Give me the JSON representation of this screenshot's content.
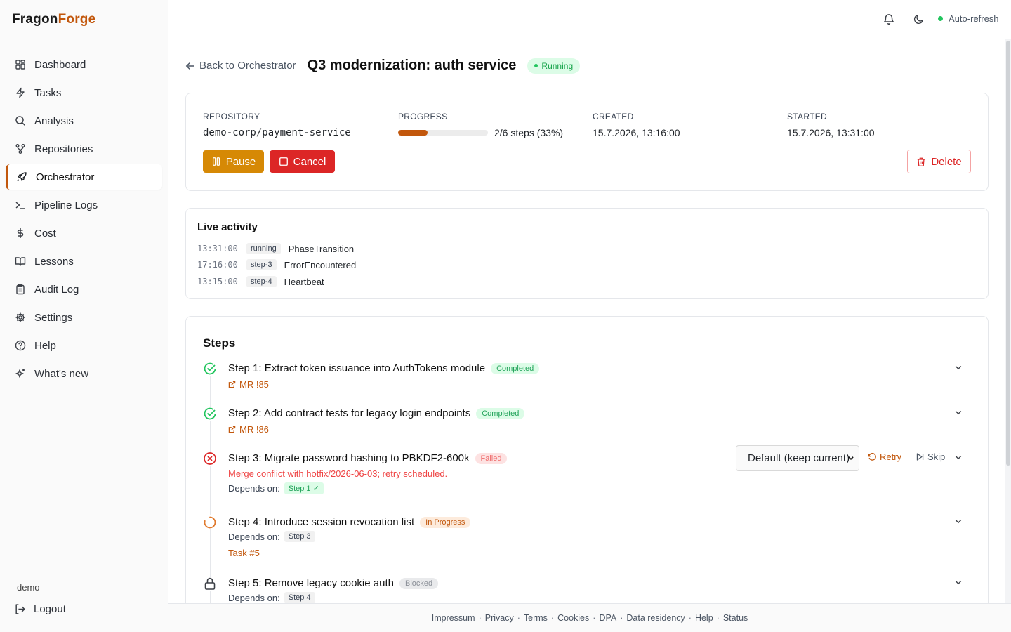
{
  "brand": {
    "part1": "Fragon",
    "part2": "Forge"
  },
  "sidebar": {
    "items": [
      {
        "label": "Dashboard",
        "icon": "grid-icon"
      },
      {
        "label": "Tasks",
        "icon": "zap-icon"
      },
      {
        "label": "Analysis",
        "icon": "search-icon"
      },
      {
        "label": "Repositories",
        "icon": "git-branch-icon"
      },
      {
        "label": "Orchestrator",
        "icon": "rocket-icon",
        "active": true
      },
      {
        "label": "Pipeline Logs",
        "icon": "terminal-icon"
      },
      {
        "label": "Cost",
        "icon": "dollar-icon"
      },
      {
        "label": "Lessons",
        "icon": "book-icon"
      },
      {
        "label": "Audit Log",
        "icon": "clipboard-icon"
      },
      {
        "label": "Settings",
        "icon": "gear-icon"
      },
      {
        "label": "Help",
        "icon": "help-circle-icon"
      },
      {
        "label": "What's new",
        "icon": "sparkles-icon"
      }
    ],
    "user": "demo",
    "logout": "Logout"
  },
  "topbar": {
    "auto_refresh": "Auto-refresh"
  },
  "header": {
    "back": "Back to Orchestrator",
    "title": "Q3 modernization: auth service",
    "status": "Running"
  },
  "summary": {
    "repository_label": "REPOSITORY",
    "repository": "demo-corp/payment-service",
    "progress_label": "PROGRESS",
    "progress_fraction": 0.33,
    "progress_text": "2/6 steps (33%)",
    "created_label": "CREATED",
    "created": "15.7.2026, 13:16:00",
    "started_label": "STARTED",
    "started": "15.7.2026, 13:31:00",
    "pause": "Pause",
    "cancel": "Cancel",
    "delete": "Delete"
  },
  "activity": {
    "title": "Live activity",
    "rows": [
      {
        "time": "13:31:00",
        "tag": "running",
        "event": "PhaseTransition"
      },
      {
        "time": "17:16:00",
        "tag": "step-3",
        "event": "ErrorEncountered"
      },
      {
        "time": "13:15:00",
        "tag": "step-4",
        "event": "Heartbeat"
      }
    ]
  },
  "steps": {
    "title": "Steps",
    "dep_label": "Depends on:",
    "items": [
      {
        "title": "Step 1: Extract token issuance into AuthTokens module",
        "status": "Completed",
        "mr": "MR !85"
      },
      {
        "title": "Step 2: Add contract tests for legacy login endpoints",
        "status": "Completed",
        "mr": "MR !86"
      },
      {
        "title": "Step 3: Migrate password hashing to PBKDF2-600k",
        "status": "Failed",
        "error": "Merge conflict with hotfix/2026-06-03; retry scheduled.",
        "depends": "Step 1 ✓",
        "select": "Default (keep current)",
        "retry": "Retry",
        "skip": "Skip"
      },
      {
        "title": "Step 4: Introduce session revocation list",
        "status": "In Progress",
        "depends": "Step 3",
        "task": "Task #5"
      },
      {
        "title": "Step 5: Remove legacy cookie auth",
        "status": "Blocked",
        "depends": "Step 4"
      }
    ]
  },
  "footer": {
    "links": [
      "Impressum",
      "Privacy",
      "Terms",
      "Cookies",
      "DPA",
      "Data residency",
      "Help",
      "Status"
    ]
  },
  "colors": {
    "accent": "#c2570c",
    "danger": "#dc2626",
    "success": "#22c55e",
    "warning": "#d68905"
  }
}
